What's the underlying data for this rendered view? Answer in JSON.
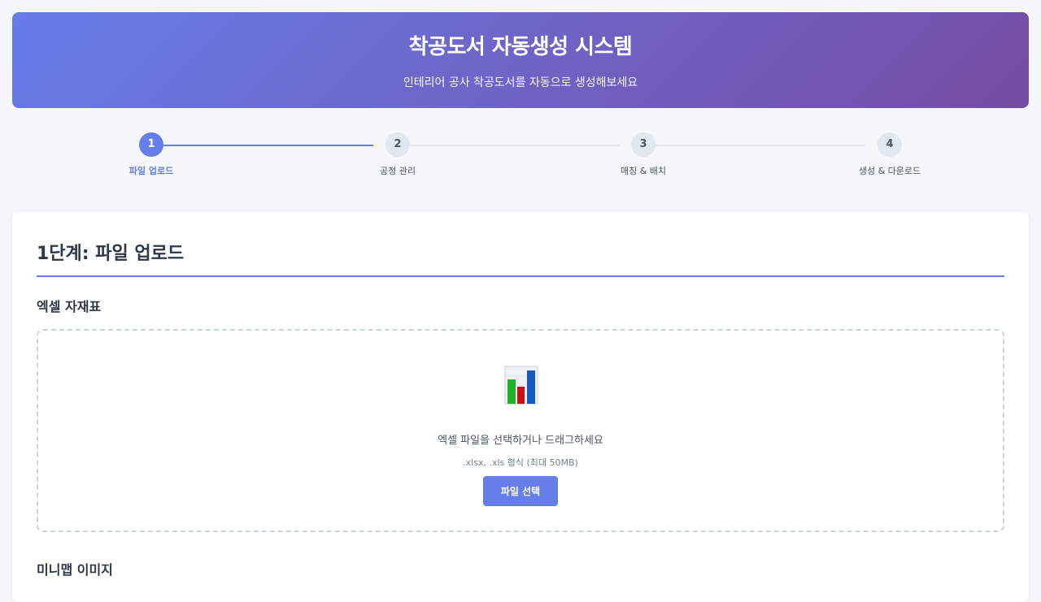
{
  "header": {
    "title": "착공도서 자동생성 시스템",
    "subtitle": "인테리어 공사 착공도서를 자동으로 생성해보세요"
  },
  "steps": [
    {
      "number": "1",
      "label": "파일 업로드",
      "active": true
    },
    {
      "number": "2",
      "label": "공정 관리",
      "active": false
    },
    {
      "number": "3",
      "label": "매칭 & 배치",
      "active": false
    },
    {
      "number": "4",
      "label": "생성 & 다운로드",
      "active": false
    }
  ],
  "card": {
    "title": "1단계: 파일 업로드",
    "excel_section": {
      "title": "엑셀 자재표",
      "icon": "bar-chart-icon",
      "prompt": "엑셀 파일을 선택하거나 드래그하세요",
      "hint": ".xlsx, .xls 형식 (최대 50MB)",
      "button_label": "파일 선택"
    },
    "minimap_section": {
      "title": "미니맵 이미지"
    }
  },
  "colors": {
    "accent": "#667eea",
    "gradient_end": "#764ba2",
    "inactive_step": "#e2e8f0"
  }
}
